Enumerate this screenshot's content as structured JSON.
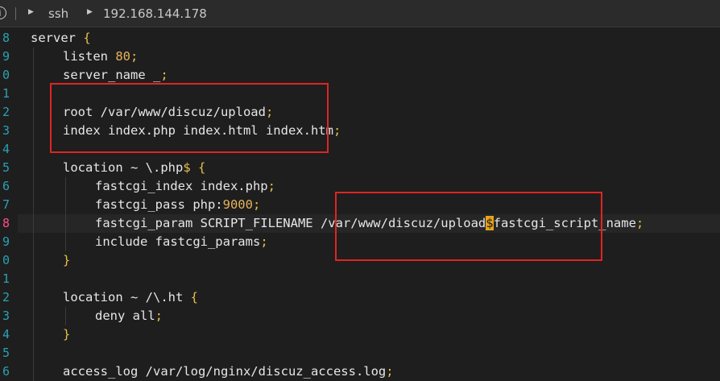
{
  "tab_bar": {
    "left_icon_glyph": "i",
    "crumbs": [
      "ssh",
      "192.168.144.178"
    ]
  },
  "gutter": {
    "line_numbers": [
      "8",
      "9",
      "0",
      "1",
      "2",
      "3",
      "4",
      "5",
      "6",
      "7",
      "8",
      "9",
      "0",
      "1",
      "2",
      "3",
      "4",
      "5",
      "6"
    ]
  },
  "code_lines": [
    {
      "indent": 0,
      "parts": [
        {
          "t": "server "
        },
        {
          "t": "{",
          "c": "punct"
        }
      ]
    },
    {
      "indent": 1,
      "parts": [
        {
          "t": "listen "
        },
        {
          "t": "80",
          "c": "num"
        },
        {
          "t": ";",
          "c": "punct"
        }
      ]
    },
    {
      "indent": 1,
      "parts": [
        {
          "t": "server_name _"
        },
        {
          "t": ";",
          "c": "punct"
        }
      ]
    },
    {
      "indent": 0,
      "parts": []
    },
    {
      "indent": 1,
      "parts": [
        {
          "t": "root /var/www/discuz/upload"
        },
        {
          "t": ";",
          "c": "punct"
        }
      ]
    },
    {
      "indent": 1,
      "parts": [
        {
          "t": "index index.php index.html index.htm"
        },
        {
          "t": ";",
          "c": "punct"
        }
      ]
    },
    {
      "indent": 0,
      "parts": []
    },
    {
      "indent": 1,
      "parts": [
        {
          "t": "location ~ \\.php"
        },
        {
          "t": "$",
          "c": "punct"
        },
        {
          "t": " "
        },
        {
          "t": "{",
          "c": "punct"
        }
      ]
    },
    {
      "indent": 2,
      "parts": [
        {
          "t": "fastcgi_index index.php"
        },
        {
          "t": ";",
          "c": "punct"
        }
      ]
    },
    {
      "indent": 2,
      "parts": [
        {
          "t": "fastcgi_pass php:"
        },
        {
          "t": "9000",
          "c": "num"
        },
        {
          "t": ";",
          "c": "punct"
        }
      ]
    },
    {
      "indent": 2,
      "parts": [
        {
          "t": "fastcgi_param SCRIPT_FILENAME /var/www/discuz/upload"
        },
        {
          "t": "$",
          "c": "cursor"
        },
        {
          "t": "fastcgi_script_name"
        },
        {
          "t": ";",
          "c": "punct"
        }
      ]
    },
    {
      "indent": 2,
      "parts": [
        {
          "t": "include fastcgi_params"
        },
        {
          "t": ";",
          "c": "punct"
        }
      ]
    },
    {
      "indent": 1,
      "parts": [
        {
          "t": "}",
          "c": "punct"
        }
      ]
    },
    {
      "indent": 0,
      "parts": []
    },
    {
      "indent": 1,
      "parts": [
        {
          "t": "location ~ /\\.ht "
        },
        {
          "t": "{",
          "c": "punct"
        }
      ]
    },
    {
      "indent": 2,
      "parts": [
        {
          "t": "deny all"
        },
        {
          "t": ";",
          "c": "punct"
        }
      ]
    },
    {
      "indent": 1,
      "parts": [
        {
          "t": "}",
          "c": "punct"
        }
      ]
    },
    {
      "indent": 0,
      "parts": []
    },
    {
      "indent": 1,
      "parts": [
        {
          "t": "access_log /var/log/nginx/discuz_access.log"
        },
        {
          "t": ";",
          "c": "punct"
        }
      ]
    }
  ],
  "active_line_index": 10,
  "annotations": [
    "red-box-root-index",
    "red-box-script-filename"
  ],
  "colors": {
    "background": "#1e1e1e",
    "line_number": "#2aa1b3",
    "active_line_number": "#ff4d8a",
    "number_literal": "#e5b45a",
    "cursor": "#e8a317",
    "annotation_box": "#e02424"
  }
}
